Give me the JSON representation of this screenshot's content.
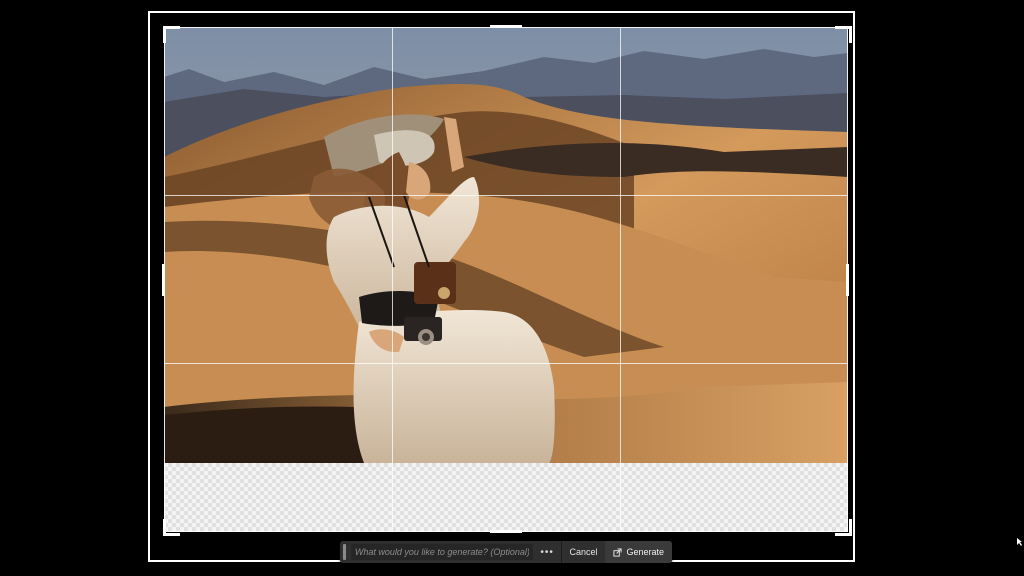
{
  "generative_bar": {
    "prompt_placeholder": "What would you like to generate? (Optional)",
    "prompt_value": "",
    "more_label": "•••",
    "cancel_label": "Cancel",
    "generate_label": "Generate",
    "generate_icon": "generate-sparkle-icon",
    "more_icon": "more-options-icon"
  },
  "canvas": {
    "photo_description_icon": "photo",
    "transparent_area_pattern": "checkerboard"
  },
  "colors": {
    "background": "#000000",
    "frame": "#ffffff",
    "bar_bg": "#2f2f2f",
    "sand": "#c98f52",
    "sky": "#8f9cb0"
  }
}
